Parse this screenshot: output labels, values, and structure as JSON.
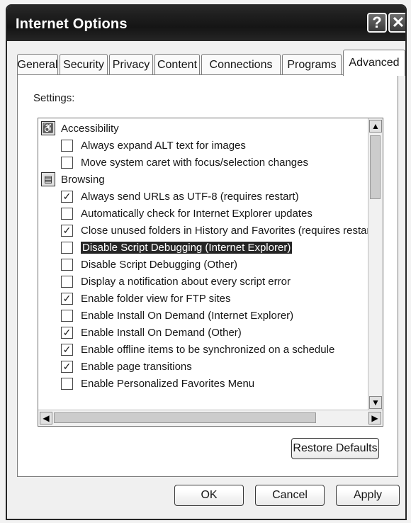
{
  "window": {
    "title": "Internet Options",
    "help_glyph": "?",
    "close_glyph": "✕"
  },
  "tabs": [
    {
      "label": "General",
      "active": false
    },
    {
      "label": "Security",
      "active": false
    },
    {
      "label": "Privacy",
      "active": false
    },
    {
      "label": "Content",
      "active": false
    },
    {
      "label": "Connections",
      "active": false
    },
    {
      "label": "Programs",
      "active": false
    },
    {
      "label": "Advanced",
      "active": true
    }
  ],
  "settings": {
    "label": "Settings:",
    "items": [
      {
        "type": "category",
        "label": "Accessibility",
        "icon": "accessibility-icon"
      },
      {
        "type": "option",
        "label": "Always expand ALT text for images",
        "checked": false
      },
      {
        "type": "option",
        "label": "Move system caret with focus/selection changes",
        "checked": false
      },
      {
        "type": "category",
        "label": "Browsing",
        "icon": "browsing-icon"
      },
      {
        "type": "option",
        "label": "Always send URLs as UTF-8 (requires restart)",
        "checked": true
      },
      {
        "type": "option",
        "label": "Automatically check for Internet Explorer updates",
        "checked": false
      },
      {
        "type": "option",
        "label": "Close unused folders in History and Favorites (requires restart)",
        "checked": true
      },
      {
        "type": "option",
        "label": "Disable Script Debugging (Internet Explorer)",
        "checked": false,
        "selected": true
      },
      {
        "type": "option",
        "label": "Disable Script Debugging (Other)",
        "checked": false
      },
      {
        "type": "option",
        "label": "Display a notification about every script error",
        "checked": false
      },
      {
        "type": "option",
        "label": "Enable folder view for FTP sites",
        "checked": true
      },
      {
        "type": "option",
        "label": "Enable Install On Demand (Internet Explorer)",
        "checked": false
      },
      {
        "type": "option",
        "label": "Enable Install On Demand (Other)",
        "checked": true
      },
      {
        "type": "option",
        "label": "Enable offline items to be synchronized on a schedule",
        "checked": true
      },
      {
        "type": "option",
        "label": "Enable page transitions",
        "checked": true
      },
      {
        "type": "option",
        "label": "Enable Personalized Favorites Menu",
        "checked": false
      }
    ]
  },
  "buttons": {
    "restore_defaults": "Restore Defaults",
    "ok": "OK",
    "cancel": "Cancel",
    "apply": "Apply"
  }
}
